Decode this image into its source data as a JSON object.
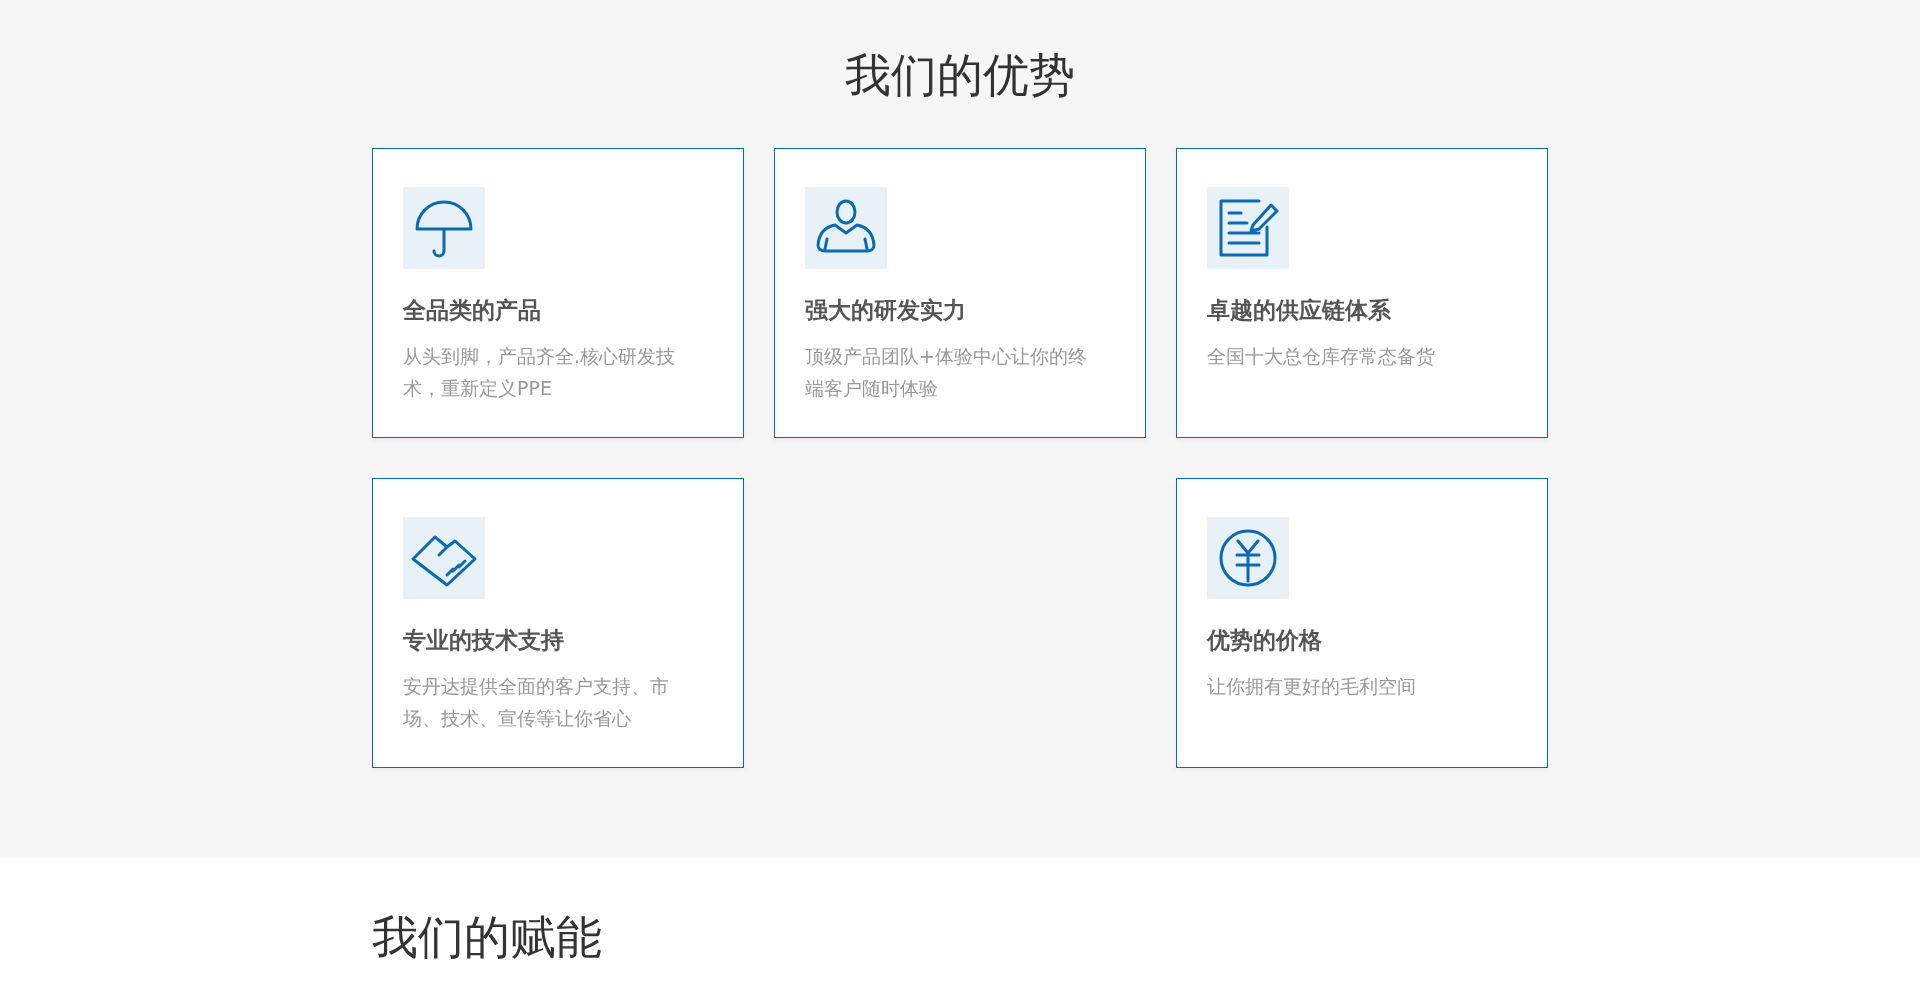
{
  "advantages": {
    "title": "我们的优势",
    "rows": [
      [
        {
          "kind": "card",
          "title": "全品类的产品",
          "text": "从头到脚，产品齐全.核心研发技术，重新定义PPE"
        },
        {
          "kind": "card",
          "title": "强大的研发实力",
          "text": "顶级产品团队+体验中心让你的终端客户随时体验"
        },
        {
          "kind": "card",
          "title": "卓越的供应链体系",
          "text": "全国十大总仓库存常态备货"
        }
      ],
      [
        {
          "kind": "card",
          "title": "专业的技术支持",
          "text": "安丹达提供全面的客户支持、市场、技术、宣传等让你省心"
        },
        {
          "kind": "empty"
        },
        {
          "kind": "card",
          "title": "优势的价格",
          "text": "让你拥有更好的毛利空间"
        }
      ]
    ]
  },
  "empowerment": {
    "title": "我们的赋能"
  }
}
